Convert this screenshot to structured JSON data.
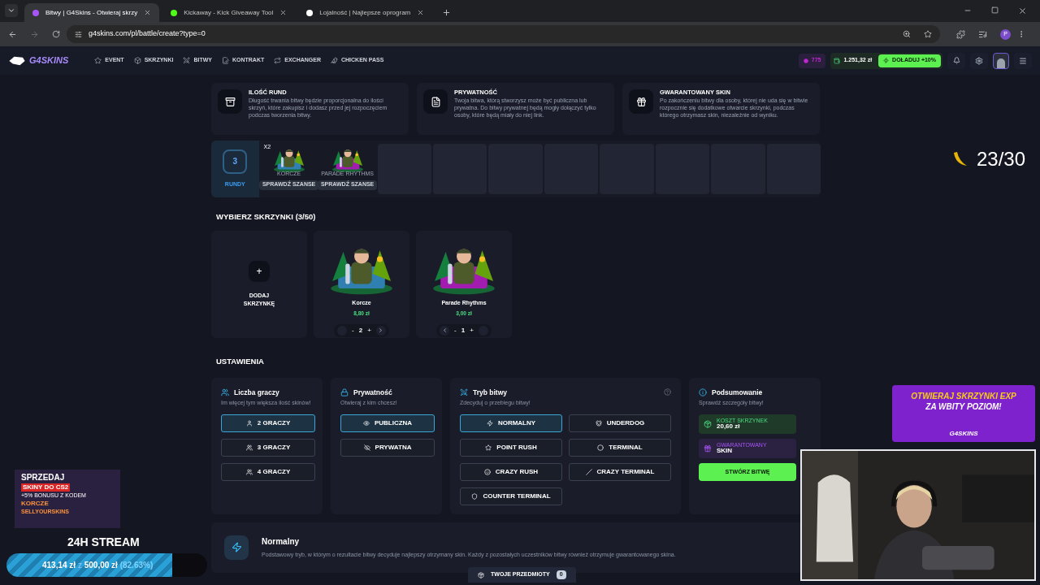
{
  "browser": {
    "tabs": [
      {
        "title": "Bitwy | G4Skins - Otwieraj skrzy",
        "selected": true,
        "color": "#a855f7"
      },
      {
        "title": "Kickaway - Kick Giveaway Tool",
        "selected": false,
        "color": "#53fc18"
      },
      {
        "title": "Lojalność | Najlepsze oprogram",
        "selected": false,
        "color": "#ffffff"
      }
    ],
    "url": "g4skins.com/pl/battle/create?type=0",
    "profile": "P"
  },
  "nav": {
    "logo": "G4SKINS",
    "items": [
      "EVENT",
      "SKRZYNKI",
      "BITWY",
      "KONTRAKT",
      "EXCHANGER",
      "CHICKEN PASS"
    ],
    "points": "775",
    "balance": "1.251,32 zł",
    "deposit": "DOŁADUJ +10%"
  },
  "info_cards": [
    {
      "title": "ILOŚĆ RUND",
      "text": "Długość trwania bitwy będzie proporcjonalna do ilości skrzyń, które zakupisz i dodasz przed jej rozpoczęciem podczas tworzenia bitwy."
    },
    {
      "title": "PRYWATNOŚĆ",
      "text": "Twoja bitwa, którą stworzysz może być publiczna lub prywatna. Do bitwy prywatnej będą mogły dołączyć tylko osoby, które będą miały do niej link."
    },
    {
      "title": "GWARANTOWANY SKIN",
      "text": "Po zakończeniu bitwy dla osoby, której nie uda się w bitwie rozpocznie się dodatkowe otwarcie skrzynki, podczas którego otrzymasz skin, niezależnie od wyniku."
    }
  ],
  "rounds": {
    "count": "3",
    "label": "RUNDY",
    "crates": [
      {
        "multiplier": "X2",
        "name": "KORCZE",
        "action": "SPRAWDŹ SZANSE"
      },
      {
        "name": "PARADE RHYTHMS",
        "action": "SPRAWDŹ SZANSE"
      }
    ]
  },
  "crates_section": {
    "title": "WYBIERZ SKRZYNKI (3/50)",
    "add_icon": "+",
    "add_label": "DODAJ SKRZYNKĘ",
    "crates": [
      {
        "name": "Korcze",
        "price": "8,80 zł",
        "minus": "-",
        "quantity": "2",
        "plus": "+",
        "can_move_left": false,
        "can_move_right": true
      },
      {
        "name": "Parade Rhythms",
        "price": "3,00 zł",
        "minus": "-",
        "quantity": "1",
        "plus": "+",
        "can_move_left": true,
        "can_move_right": false
      }
    ]
  },
  "settings": {
    "title": "USTAWIENIA",
    "players": {
      "title": "Liczba graczy",
      "subtitle": "Im więcej tym większa ilość skinów!",
      "options": [
        {
          "label": "2 GRACZY",
          "selected": true
        },
        {
          "label": "3 GRACZY",
          "selected": false
        },
        {
          "label": "4 GRACZY",
          "selected": false
        }
      ]
    },
    "privacy": {
      "title": "Prywatność",
      "subtitle": "Otwieraj z kim chcesz!",
      "options": [
        {
          "label": "PUBLICZNA",
          "selected": true
        },
        {
          "label": "PRYWATNA",
          "selected": false
        }
      ]
    },
    "mode": {
      "title": "Tryb bitwy",
      "subtitle": "Zdecyduj o przebiegu bitwy!",
      "options": [
        {
          "label": "NORMALNY",
          "selected": true
        },
        {
          "label": "UNDERDOG",
          "selected": false
        },
        {
          "label": "POINT RUSH",
          "selected": false
        },
        {
          "label": "TERMINAL",
          "selected": false
        },
        {
          "label": "CRAZY RUSH",
          "selected": false
        },
        {
          "label": "CRAZY TERMINAL",
          "selected": false
        },
        {
          "label": "COUNTER TERMINAL",
          "selected": false
        }
      ]
    },
    "summary": {
      "title": "Podsumowanie",
      "subtitle": "Sprawdź szczegóły bitwy!",
      "cost_label": "KOSZT SKRZYNEK",
      "cost": "20,60 zł",
      "guaranteed_label": "GWARANTOWANY",
      "guaranteed": "SKIN",
      "create": "STWÓRZ BITWĘ"
    }
  },
  "mode_description": {
    "title": "Normalny",
    "text": "Podstawowy tryb, w którym o rezultacie bitwy decyduje najlepszy otrzymany skin. Każdy z pozostałych uczestników bitwy również otrzymuje gwarantowanego skina."
  },
  "items_button": {
    "label": "TWOJE PRZEDMIOTY",
    "count": "0"
  },
  "overlay": {
    "goal": "23/30",
    "ad": {
      "lines": [
        "SPRZEDAJ",
        "SKINY DO CS2",
        "+5% BONUSU Z KODEM",
        "KORCZE"
      ],
      "brand": "SELLYOURSKINS"
    },
    "stream_title": "24H STREAM",
    "progress": {
      "raised": "413,14 zł",
      "separator": "z",
      "target": "500,00 zł",
      "percent": "(82.63%)",
      "level": 0.8263
    },
    "exp_banner": {
      "lines": [
        "OTWIERAJ SKRZYNKI EXP",
        "ZA WBITY POZIOM!"
      ],
      "brand": "G4SKINS"
    }
  }
}
